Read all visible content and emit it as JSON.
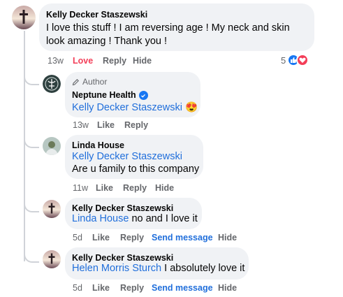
{
  "comments": [
    {
      "author": "Kelly Decker Staszewski",
      "text": "I love this stuff ! I am reversing age ! My neck and skin look amazing ! Thank you !",
      "time": "13w",
      "reaction_label": "Love",
      "reply_label": "Reply",
      "hide_label": "Hide",
      "reaction_count": "5"
    },
    {
      "badge": "Author",
      "author": "Neptune Health",
      "mention": "Kelly Decker Staszewski",
      "emoji": "😍",
      "time": "13w",
      "like_label": "Like",
      "reply_label": "Reply"
    },
    {
      "author": "Linda House",
      "mention": "Kelly Decker Staszewski",
      "text": "Are u family to this company",
      "time": "11w",
      "like_label": "Like",
      "reply_label": "Reply",
      "hide_label": "Hide"
    },
    {
      "author": "Kelly Decker Staszewski",
      "mention": "Linda House",
      "text": " no and I love it",
      "time": "5d",
      "like_label": "Like",
      "reply_label": "Reply",
      "send_label": "Send message",
      "hide_label": "Hide"
    },
    {
      "author": "Kelly Decker Staszewski",
      "mention": "Helen Morris Sturch",
      "text": " I absolutely love it",
      "time": "5d",
      "like_label": "Like",
      "reply_label": "Reply",
      "send_label": "Send message",
      "hide_label": "Hide"
    }
  ],
  "colors": {
    "bubble": "#f0f2f5",
    "mention": "#216fdb",
    "love": "#f33e58",
    "like": "#1877f2",
    "meta": "#65676b"
  },
  "icons": [
    "cross-sunset-avatar",
    "neptune-logo-avatar",
    "linda-avatar",
    "pencil-icon",
    "verified-badge-icon",
    "like-reaction-icon",
    "love-reaction-icon"
  ]
}
